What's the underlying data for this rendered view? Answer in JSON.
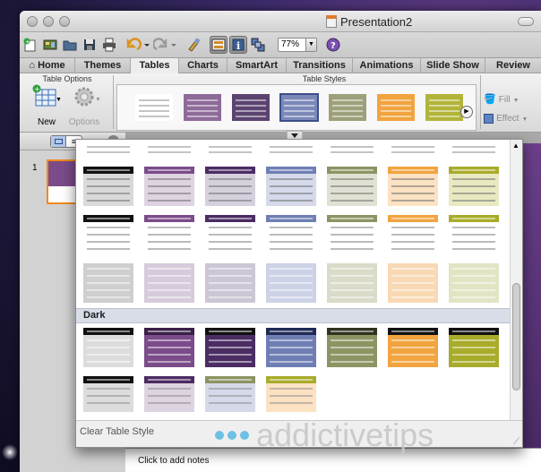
{
  "window": {
    "title": "Presentation2"
  },
  "toolbar": {
    "zoom": "77%"
  },
  "ribbon": {
    "tabs": [
      {
        "label": "Home",
        "icon": "home-icon"
      },
      {
        "label": "Themes"
      },
      {
        "label": "Tables",
        "active": true
      },
      {
        "label": "Charts"
      },
      {
        "label": "SmartArt"
      },
      {
        "label": "Transitions"
      },
      {
        "label": "Animations"
      },
      {
        "label": "Slide Show"
      },
      {
        "label": "Review"
      }
    ],
    "table_options_label": "Table Options",
    "table_styles_label": "Table Styles",
    "new_label": "New",
    "options_label": "Options",
    "fill_label": "Fill",
    "effect_label": "Effect"
  },
  "sidebar": {
    "slide_number": "1"
  },
  "gallery": {
    "section_dark": "Dark",
    "clear_label": "Clear Table Style"
  },
  "notes": {
    "placeholder": "Click to add notes"
  },
  "watermark": {
    "text": "addictivetips"
  },
  "colors": {
    "purple": "#7b4b8a",
    "darkpurple": "#4b2c63",
    "blue": "#6f7fb5",
    "olive": "#8c9464",
    "orange": "#f2a440",
    "lime": "#a8ac2a",
    "black": "#111111",
    "gray": "#c8c8c8"
  }
}
